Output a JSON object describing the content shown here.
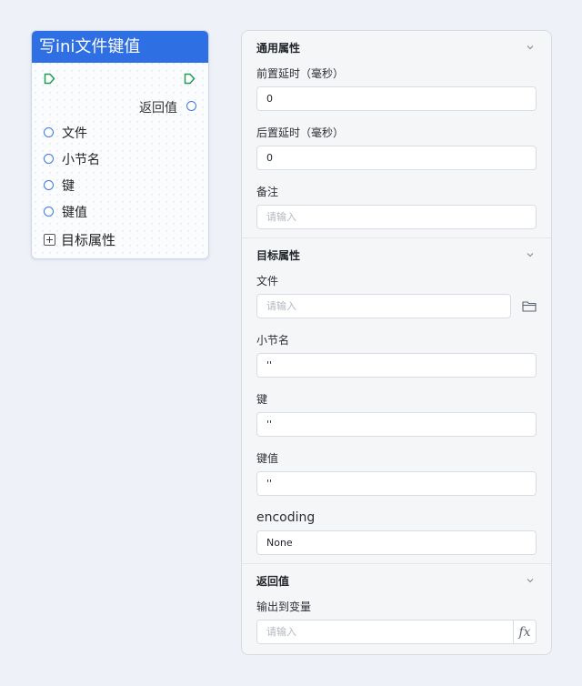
{
  "node": {
    "title": "写ini文件键值",
    "return_label": "返回值",
    "params": [
      "文件",
      "小节名",
      "键",
      "键值"
    ],
    "group_label": "目标属性"
  },
  "panel": {
    "general": {
      "title": "通用属性",
      "pre_delay_label": "前置延时（毫秒）",
      "pre_delay_value": "0",
      "post_delay_label": "后置延时（毫秒）",
      "post_delay_value": "0",
      "note_label": "备注",
      "note_placeholder": "请输入"
    },
    "target": {
      "title": "目标属性",
      "file_label": "文件",
      "file_placeholder": "请输入",
      "section_label": "小节名",
      "section_value": "''",
      "key_label": "键",
      "key_value": "''",
      "keyvalue_label": "键值",
      "keyvalue_value": "''",
      "encoding_label": "encoding",
      "encoding_value": "None"
    },
    "return": {
      "title": "返回值",
      "output_label": "输出到变量",
      "output_placeholder": "请输入",
      "fx_label": "fx"
    }
  },
  "colors": {
    "header_blue": "#2f6fe4",
    "port_blue": "#3b78e7",
    "flow_green": "#1f9d55"
  }
}
